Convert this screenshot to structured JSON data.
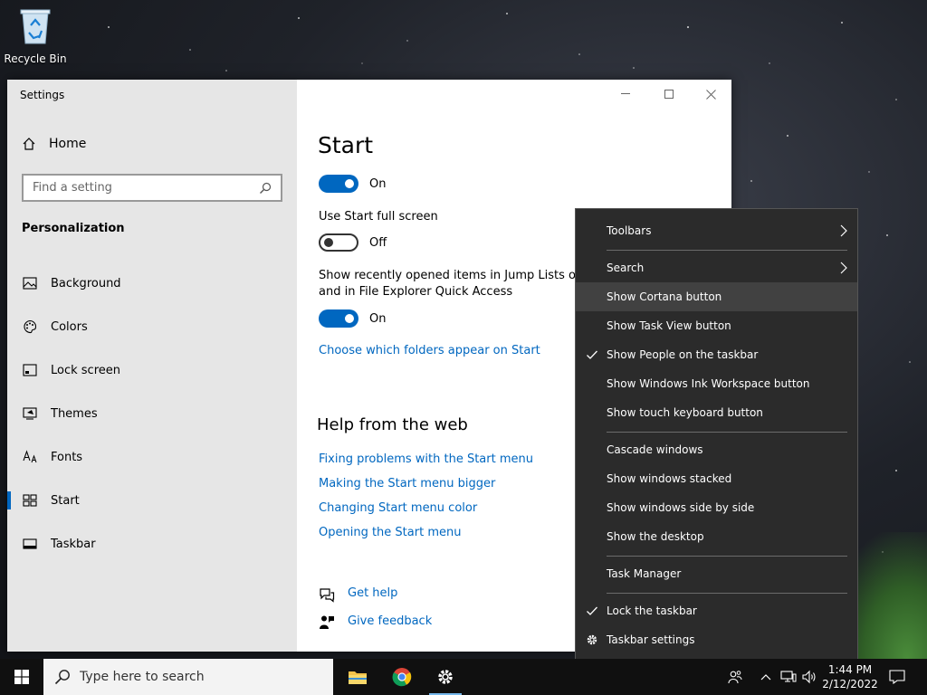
{
  "desktop": {
    "recycle_bin_label": "Recycle Bin"
  },
  "settings_window": {
    "title": "Settings",
    "home_label": "Home",
    "search_placeholder": "Find a setting",
    "section_title": "Personalization",
    "nav_items": [
      {
        "label": "Background",
        "icon": "picture-icon"
      },
      {
        "label": "Colors",
        "icon": "palette-icon"
      },
      {
        "label": "Lock screen",
        "icon": "lock-screen-icon"
      },
      {
        "label": "Themes",
        "icon": "themes-icon"
      },
      {
        "label": "Fonts",
        "icon": "fonts-icon"
      },
      {
        "label": "Start",
        "icon": "start-icon",
        "active": true
      },
      {
        "label": "Taskbar",
        "icon": "taskbar-icon"
      }
    ],
    "content": {
      "page_title": "Start",
      "toggle1_state": "On",
      "full_screen_label": "Use Start full screen",
      "toggle2_state": "Off",
      "jump_lists_label_line1": "Show recently opened items in Jump Lists on S",
      "jump_lists_label_line2": "and in File Explorer Quick Access",
      "toggle3_state": "On",
      "folders_link": "Choose which folders appear on Start",
      "help_title": "Help from the web",
      "help_links": [
        "Fixing problems with the Start menu",
        "Making the Start menu bigger",
        "Changing Start menu color",
        "Opening the Start menu"
      ],
      "get_help": "Get help",
      "give_feedback": "Give feedback"
    }
  },
  "context_menu": {
    "items": [
      {
        "label": "Toolbars",
        "submenu": true
      },
      {
        "label": "Search",
        "submenu": true
      },
      {
        "label": "Show Cortana button",
        "hover": true
      },
      {
        "label": "Show Task View button"
      },
      {
        "label": "Show People on the taskbar",
        "checked": true
      },
      {
        "label": "Show Windows Ink Workspace button"
      },
      {
        "label": "Show touch keyboard button"
      },
      {
        "label": "Cascade windows"
      },
      {
        "label": "Show windows stacked"
      },
      {
        "label": "Show windows side by side"
      },
      {
        "label": "Show the desktop"
      },
      {
        "label": "Task Manager"
      },
      {
        "label": "Lock the taskbar",
        "checked": true
      },
      {
        "label": "Taskbar settings",
        "icon": "gear-icon"
      }
    ]
  },
  "taskbar": {
    "search_placeholder": "Type here to search",
    "time": "1:44 PM",
    "date": "2/12/2022"
  },
  "colors": {
    "accent": "#0067c0",
    "menu_bg": "#2b2b2b",
    "taskbar_bg": "#101010"
  }
}
